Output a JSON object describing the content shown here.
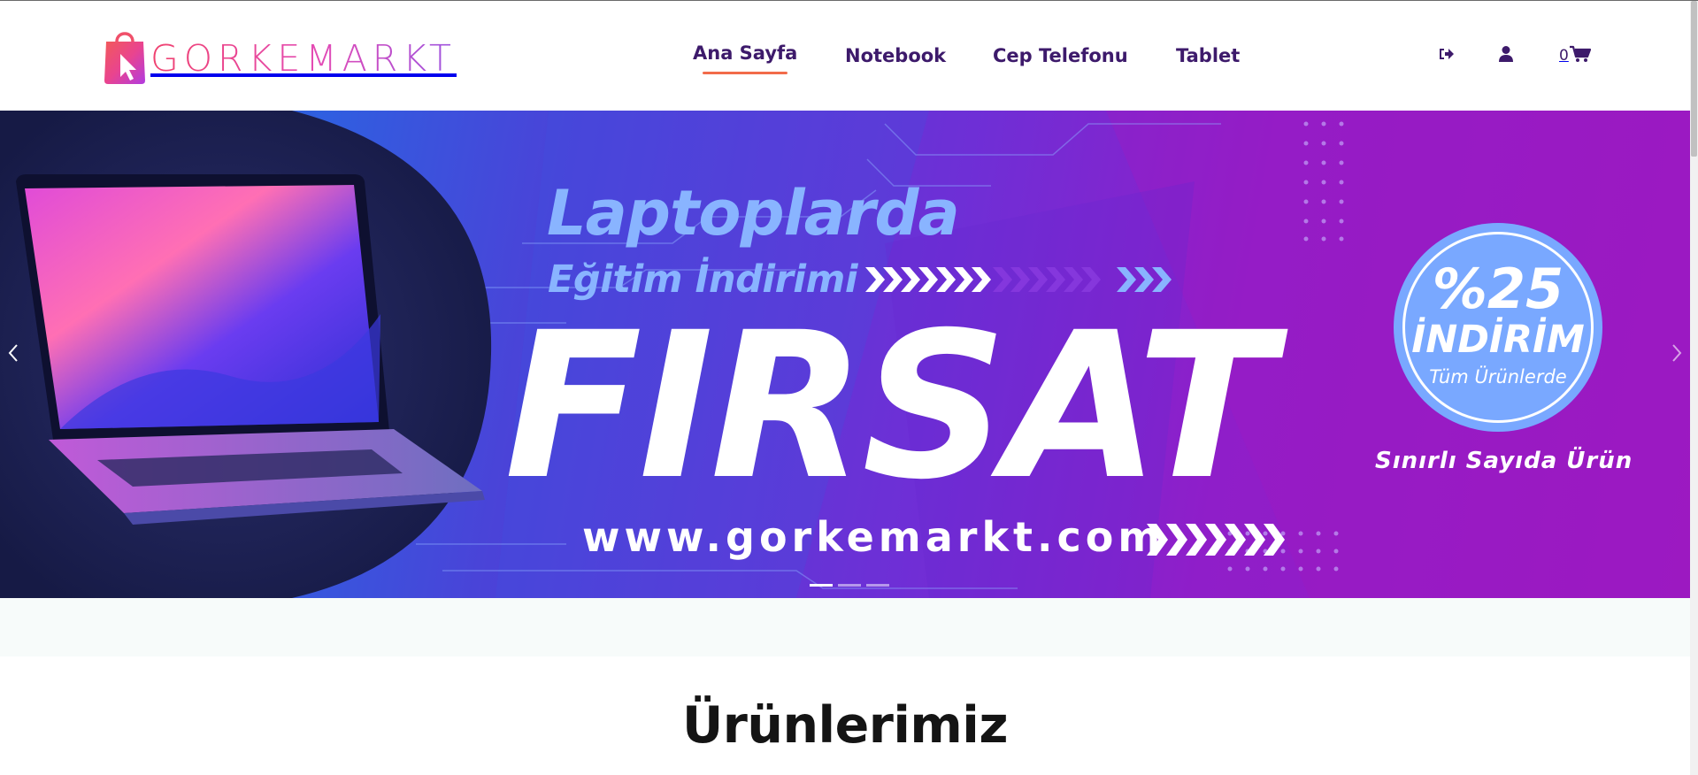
{
  "brand": {
    "name": "GORKEMARKT",
    "colors": {
      "start": "#f0426f",
      "mid": "#e34bb5",
      "end": "#9c53e0"
    }
  },
  "nav": {
    "items": [
      {
        "label": "Ana Sayfa",
        "active": true
      },
      {
        "label": "Notebook",
        "active": false
      },
      {
        "label": "Cep Telefonu",
        "active": false
      },
      {
        "label": "Tablet",
        "active": false
      }
    ],
    "accent_color": "#f26b4a",
    "text_color": "#3d1a6b"
  },
  "header_icons": {
    "login": "sign-in-icon",
    "account": "user-icon",
    "cart": "cart-icon",
    "cart_count": "0"
  },
  "hero": {
    "line1": "Laptoplarda",
    "line2": "Eğitim İndirimi",
    "headline": "FIRSAT",
    "url": "www.gorkemarkt.com",
    "badge": {
      "percent": "%25",
      "label": "İNDİRİM",
      "sub": "Tüm Ürünlerde"
    },
    "limited": "Sınırlı Sayıda Ürün",
    "slides": 3,
    "active_slide": 1,
    "prev_icon": "chevron-left-icon",
    "next_icon": "chevron-right-icon"
  },
  "section": {
    "title": "Ürünlerimiz"
  }
}
